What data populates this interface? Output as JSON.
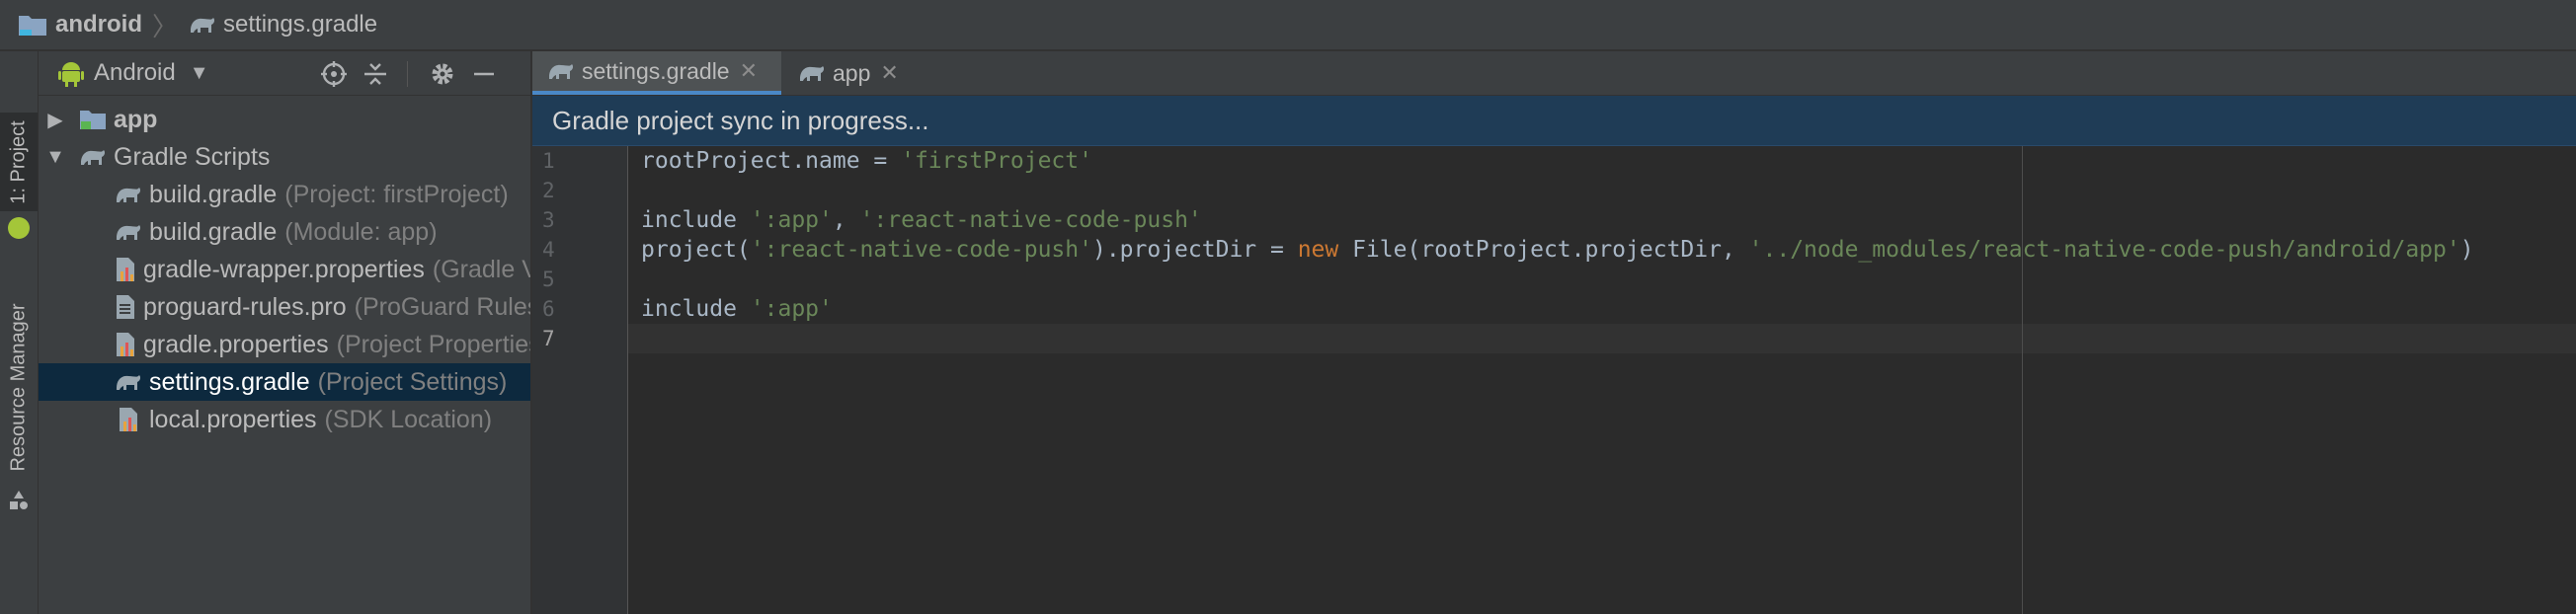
{
  "breadcrumb": {
    "root": "android",
    "file": "settings.gradle"
  },
  "tool_strip": {
    "project_tab": "1: Project",
    "resource_tab": "Resource Manager"
  },
  "project_panel": {
    "view_selector": "Android",
    "tree": [
      {
        "name": "app",
        "hint": "",
        "icon": "module-folder-icon",
        "arrow": "▶",
        "bold": true
      },
      {
        "name": "Gradle Scripts",
        "hint": "",
        "icon": "gradle-elephant-icon",
        "arrow": "▼"
      },
      {
        "name": "build.gradle",
        "hint": "(Project: firstProject)",
        "icon": "gradle-elephant-icon"
      },
      {
        "name": "build.gradle",
        "hint": "(Module: app)",
        "icon": "gradle-elephant-icon"
      },
      {
        "name": "gradle-wrapper.properties",
        "hint": "(Gradle Version)",
        "icon": "properties-file-icon"
      },
      {
        "name": "proguard-rules.pro",
        "hint": "(ProGuard Rules for app)",
        "icon": "text-file-icon"
      },
      {
        "name": "gradle.properties",
        "hint": "(Project Properties)",
        "icon": "properties-file-icon"
      },
      {
        "name": "settings.gradle",
        "hint": "(Project Settings)",
        "icon": "gradle-elephant-icon",
        "selected": true
      },
      {
        "name": "local.properties",
        "hint": "(SDK Location)",
        "icon": "properties-file-icon"
      }
    ]
  },
  "editor": {
    "tabs": [
      {
        "label": "settings.gradle",
        "active": true
      },
      {
        "label": "app",
        "active": false
      }
    ],
    "banner": "Gradle project sync in progress...",
    "line_numbers": [
      "1",
      "2",
      "3",
      "4",
      "5",
      "6",
      "7"
    ],
    "current_line": "7",
    "code": {
      "l1": [
        "rootProject.name = ",
        "'firstProject'"
      ],
      "l3": [
        "include ",
        "':app'",
        ", ",
        "':react-native-code-push'"
      ],
      "l4": [
        "project(",
        "':react-native-code-push'",
        ").projectDir = ",
        "new",
        " File(rootProject.projectDir, ",
        "'../node_modules/react-native-code-push/android/app'",
        ")"
      ],
      "l6": [
        "include ",
        "':app'"
      ]
    }
  },
  "colors": {
    "background": "#2b2b2b",
    "panel": "#3c3f41",
    "selection": "#0d293e",
    "banner": "#1f3c56",
    "string": "#6a8759",
    "keyword": "#cc7832",
    "android_green": "#a4c639",
    "tab_underline": "#4a88c7"
  }
}
